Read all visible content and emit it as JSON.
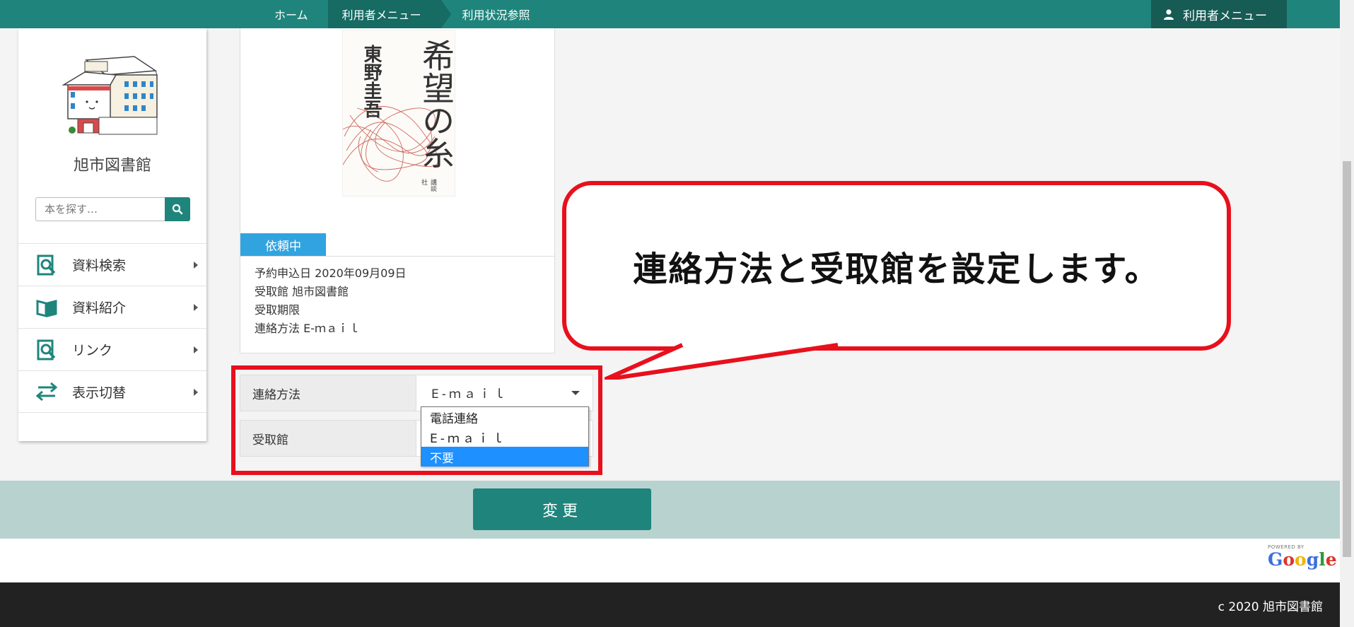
{
  "topbar": {
    "breadcrumbs": [
      "ホーム",
      "利用者メニュー",
      "利用状況参照"
    ],
    "user_menu": "利用者メニュー"
  },
  "sidebar": {
    "library_name": "旭市図書館",
    "search_placeholder": "本を探す…",
    "items": [
      {
        "label": "資料検索",
        "icon": "search-book-icon"
      },
      {
        "label": "資料紹介",
        "icon": "open-book-icon"
      },
      {
        "label": "リンク",
        "icon": "search-book-icon"
      },
      {
        "label": "表示切替",
        "icon": "swap-arrows-icon"
      }
    ]
  },
  "book": {
    "cover_title": "希望の糸",
    "cover_author": "東野圭吾",
    "cover_publisher": "講談社",
    "status": "依頼中",
    "info": [
      "予約申込日 2020年09月09日",
      "受取館 旭市図書館",
      "受取期限",
      "連絡方法 E-ｍａｉｌ"
    ]
  },
  "form": {
    "contact_label": "連絡方法",
    "contact_value": "E-ｍａｉｌ",
    "pickup_label": "受取館",
    "options": [
      "電話連絡",
      "E-ｍａｉｌ",
      "不要"
    ],
    "selected_option": "不要"
  },
  "callout": {
    "text": "連絡方法と受取館を設定します。"
  },
  "change_button": "変更",
  "footer": {
    "powered_by": "POWERED BY",
    "google": "Google",
    "copyright": "c 2020 旭市図書館"
  },
  "colors": {
    "primary": "#1f857c",
    "status_blue": "#31a4e0",
    "highlight_red": "#e8101d",
    "band": "#b8d3cf"
  }
}
